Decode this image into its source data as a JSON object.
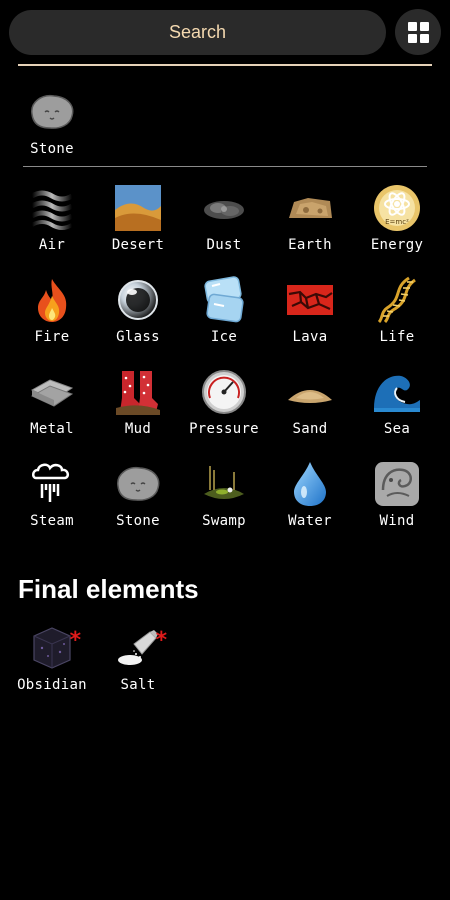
{
  "header": {
    "search_label": "Search",
    "grid_button_icon": "grid-view-icon"
  },
  "recent": [
    {
      "label": "Stone",
      "icon": "stone-icon"
    }
  ],
  "elements": [
    {
      "label": "Air",
      "icon": "air-icon"
    },
    {
      "label": "Desert",
      "icon": "desert-icon"
    },
    {
      "label": "Dust",
      "icon": "dust-icon"
    },
    {
      "label": "Earth",
      "icon": "earth-icon"
    },
    {
      "label": "Energy",
      "icon": "energy-icon"
    },
    {
      "label": "Fire",
      "icon": "fire-icon"
    },
    {
      "label": "Glass",
      "icon": "glass-icon"
    },
    {
      "label": "Ice",
      "icon": "ice-icon"
    },
    {
      "label": "Lava",
      "icon": "lava-icon"
    },
    {
      "label": "Life",
      "icon": "life-icon"
    },
    {
      "label": "Metal",
      "icon": "metal-icon"
    },
    {
      "label": "Mud",
      "icon": "mud-icon"
    },
    {
      "label": "Pressure",
      "icon": "pressure-icon"
    },
    {
      "label": "Sand",
      "icon": "sand-icon"
    },
    {
      "label": "Sea",
      "icon": "sea-icon"
    },
    {
      "label": "Steam",
      "icon": "steam-icon"
    },
    {
      "label": "Stone",
      "icon": "stone-icon"
    },
    {
      "label": "Swamp",
      "icon": "swamp-icon"
    },
    {
      "label": "Water",
      "icon": "water-icon"
    },
    {
      "label": "Wind",
      "icon": "wind-icon"
    }
  ],
  "final_section": {
    "title": "Final elements",
    "items": [
      {
        "label": "Obsidian",
        "icon": "obsidian-icon",
        "marker": "*"
      },
      {
        "label": "Salt",
        "icon": "salt-icon",
        "marker": "*"
      }
    ]
  },
  "energy_formula": "E=mc²",
  "colors": {
    "search_text": "#f4d9b0",
    "divider": "#e6d2b8",
    "final_marker": "#e01b1b"
  }
}
